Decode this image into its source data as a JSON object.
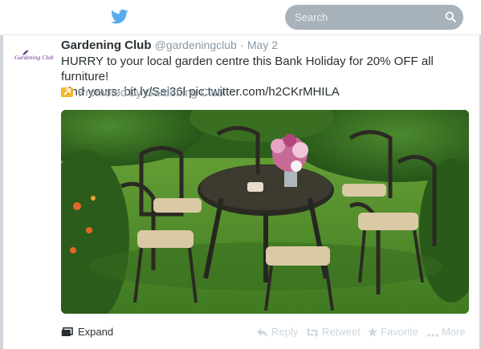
{
  "topbar": {
    "logo_icon": "twitter-bird-icon",
    "search_placeholder": "Search",
    "search_icon": "magnifier-icon"
  },
  "tweet": {
    "avatar_text": "Gardening Club",
    "name": "Gardening Club",
    "handle": "@gardeningclub",
    "separator": "·",
    "date": "May 2",
    "text_line1": "HURRY to your local garden centre this Bank Holiday for 20% OFF all furniture!",
    "text_line2": "Find yours: bit.ly/Sei36l pic.twitter.com/h2CKrMHILA",
    "promoted_label": "Promoted by Gardening Club",
    "photo_description_icon": "garden-furniture-photo",
    "actions": {
      "expand": "Expand",
      "reply": "Reply",
      "retweet": "Retweet",
      "favorite": "Favorite",
      "more": "More"
    }
  },
  "colors": {
    "brand_blue": "#55acee",
    "promoted_orange": "#f5b52e",
    "muted_text": "#8899a6",
    "action_inactive": "#ccd6dd"
  }
}
